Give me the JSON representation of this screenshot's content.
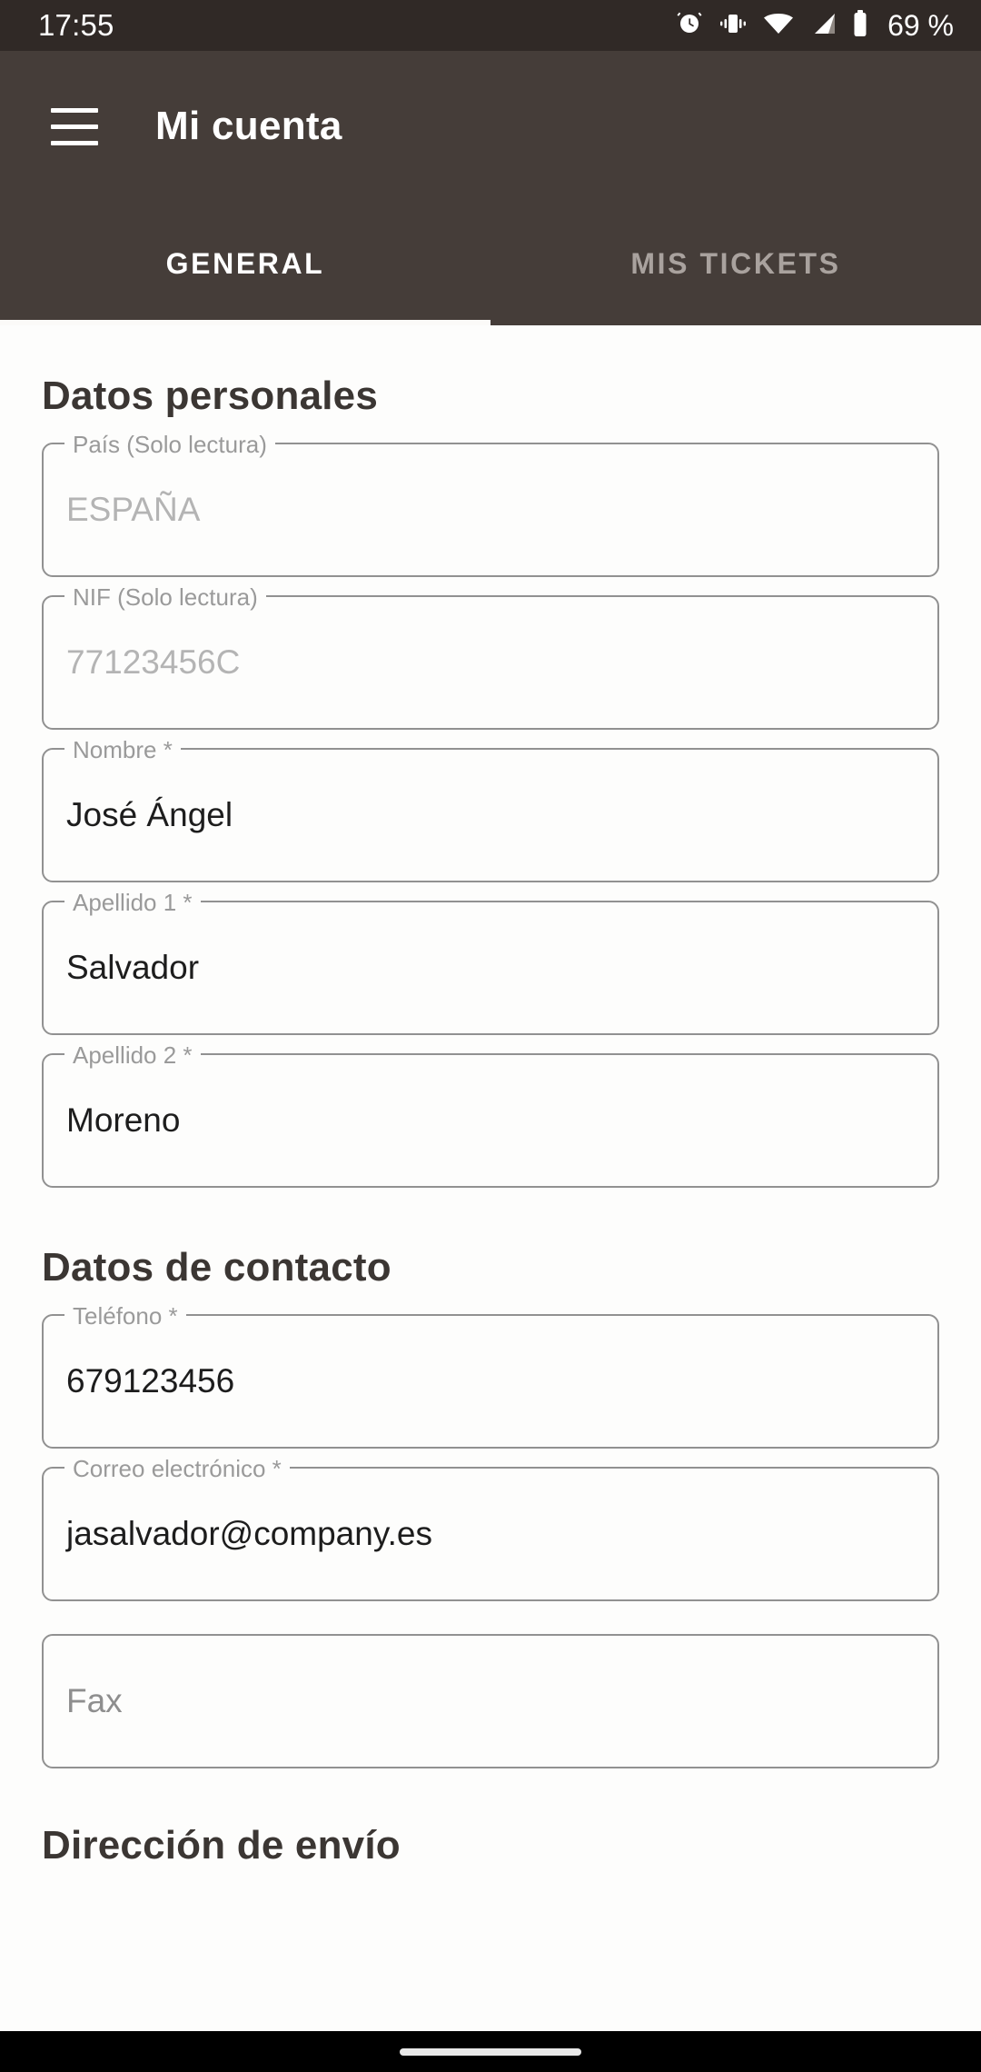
{
  "status_bar": {
    "time": "17:55",
    "battery_percent": "69 %",
    "icons": [
      "alarm-icon",
      "vibrate-icon",
      "wifi-icon",
      "cellular-signal-icon",
      "battery-icon"
    ],
    "background_color": "#302926"
  },
  "app_bar": {
    "menu_icon": "hamburger-menu-icon",
    "title": "Mi cuenta",
    "background_color": "#453d39",
    "tabs": [
      {
        "label": "GENERAL",
        "active": true
      },
      {
        "label": "MIS TICKETS",
        "active": false
      }
    ],
    "active_indicator_color": "#fbfaf8"
  },
  "sections": [
    {
      "title": "Datos personales",
      "fields": [
        {
          "label": "País (Solo lectura)",
          "value": "ESPAÑA",
          "state": "readonly"
        },
        {
          "label": "NIF (Solo lectura)",
          "value": "77123456C",
          "state": "readonly"
        },
        {
          "label": "Nombre *",
          "value": "José Ángel",
          "state": "filled"
        },
        {
          "label": "Apellido 1 *",
          "value": "Salvador",
          "state": "filled"
        },
        {
          "label": "Apellido 2 *",
          "value": "Moreno",
          "state": "filled"
        }
      ]
    },
    {
      "title": "Datos de contacto",
      "fields": [
        {
          "label": "Teléfono *",
          "value": "679123456",
          "state": "filled"
        },
        {
          "label": "Correo electrónico *",
          "value": "jasalvador@company.es",
          "state": "filled"
        },
        {
          "label": "",
          "value": "",
          "placeholder": "Fax",
          "state": "empty"
        }
      ]
    },
    {
      "title": "Dirección de envío",
      "fields": []
    }
  ],
  "nav_bar": {
    "gesture_pill": "gesture-home-indicator",
    "background_color": "#000000"
  }
}
